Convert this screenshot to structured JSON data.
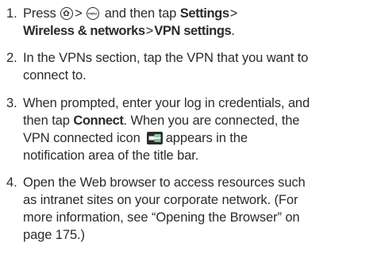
{
  "steps": [
    {
      "number": "1.",
      "line1": {
        "prefix": "Press",
        "gt1": ">",
        "after_icons": "and then tap",
        "settings": "Settings",
        "gt2": ">"
      },
      "line2": {
        "wireless": "Wireless & networks",
        "gt": ">",
        "vpn_settings": "VPN settings",
        "period": "."
      },
      "icons": [
        "home-icon",
        "menu-icon"
      ]
    },
    {
      "number": "2.",
      "lines": [
        "In the VPNs section, tap the VPN that you want to",
        "connect to."
      ]
    },
    {
      "number": "3.",
      "line1": "When prompted, enter your log in credentials, and",
      "line2": {
        "prefix": "then tap",
        "connect": "Connect",
        "suffix": ". When you are connected, the"
      },
      "line3": {
        "prefix": "VPN connected icon",
        "suffix": "appears in the"
      },
      "line4": "notification area of the title bar.",
      "icon": "vpn-connected-icon"
    },
    {
      "number": "4.",
      "lines": [
        "Open the Web browser to access resources such",
        "as intranet sites on your corporate network. (For",
        "more information, see “Opening the Browser” on",
        "page 175.)"
      ]
    }
  ]
}
